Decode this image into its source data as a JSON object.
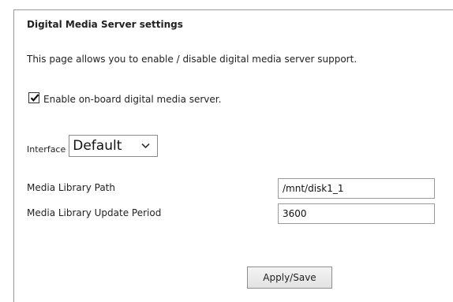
{
  "page": {
    "title": "Digital Media Server settings",
    "description": "This page allows you to enable / disable digital media server support."
  },
  "enable": {
    "checked": true,
    "label": "Enable on-board digital media server."
  },
  "interface": {
    "label": "Interface",
    "selected": "Default",
    "dropdown_icon": "chevron-down-icon"
  },
  "fields": {
    "library_path": {
      "label": "Media Library Path",
      "value": "/mnt/disk1_1"
    },
    "update_period": {
      "label": "Media Library Update Period",
      "value": "3600"
    }
  },
  "actions": {
    "apply_label": "Apply/Save"
  }
}
